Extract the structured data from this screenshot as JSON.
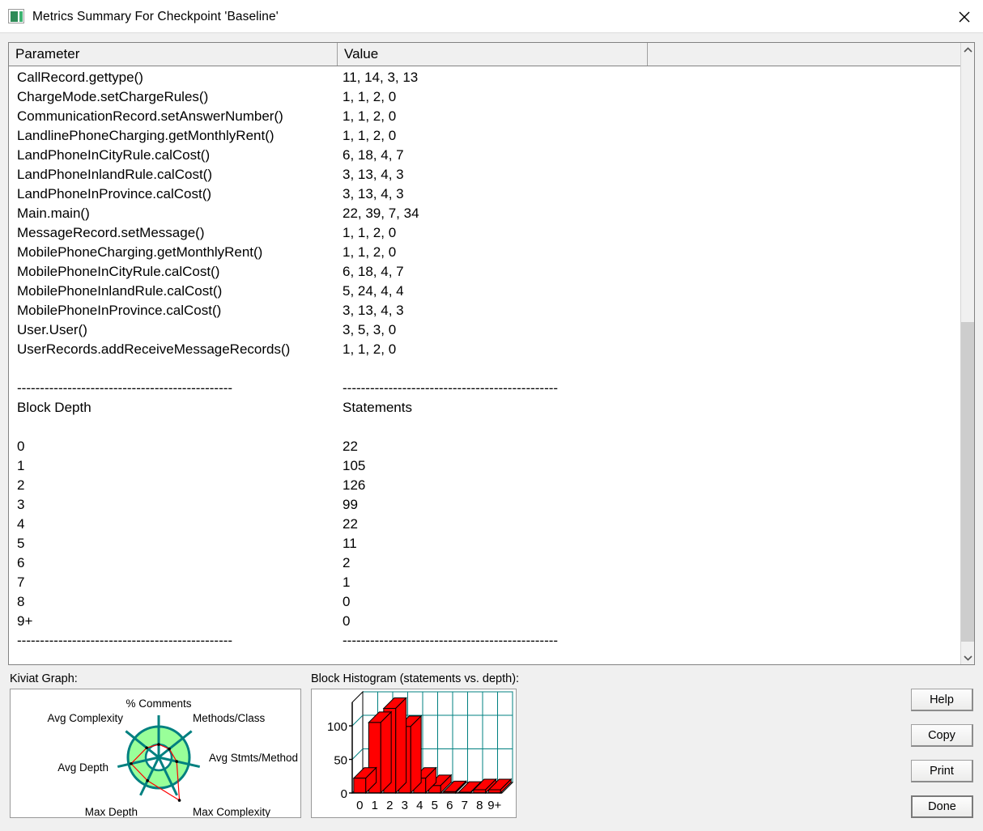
{
  "window": {
    "title": "Metrics Summary For Checkpoint 'Baseline'",
    "icon": "metrics-window-icon",
    "close_icon": "close-icon"
  },
  "report": {
    "columns": [
      "Parameter",
      "Value",
      ""
    ],
    "rows": [
      {
        "parameter": "CallRecord.gettype()",
        "value": "11, 14, 3, 13"
      },
      {
        "parameter": "ChargeMode.setChargeRules()",
        "value": "1, 1, 2, 0"
      },
      {
        "parameter": "CommunicationRecord.setAnswerNumber()",
        "value": "1, 1, 2, 0"
      },
      {
        "parameter": "LandlinePhoneCharging.getMonthlyRent()",
        "value": "1, 1, 2, 0"
      },
      {
        "parameter": "LandPhoneInCityRule.calCost()",
        "value": "6, 18, 4, 7"
      },
      {
        "parameter": "LandPhoneInlandRule.calCost()",
        "value": "3, 13, 4, 3"
      },
      {
        "parameter": "LandPhoneInProvince.calCost()",
        "value": "3, 13, 4, 3"
      },
      {
        "parameter": "Main.main()",
        "value": "22, 39, 7, 34"
      },
      {
        "parameter": "MessageRecord.setMessage()",
        "value": "1, 1, 2, 0"
      },
      {
        "parameter": "MobilePhoneCharging.getMonthlyRent()",
        "value": "1, 1, 2, 0"
      },
      {
        "parameter": "MobilePhoneInCityRule.calCost()",
        "value": "6, 18, 4, 7"
      },
      {
        "parameter": "MobilePhoneInlandRule.calCost()",
        "value": "5, 24, 4, 4"
      },
      {
        "parameter": "MobilePhoneInProvince.calCost()",
        "value": "3, 13, 4, 3"
      },
      {
        "parameter": "User.User()",
        "value": "3, 5, 3, 0"
      },
      {
        "parameter": "UserRecords.addReceiveMessageRecords()",
        "value": "1, 1, 2, 0"
      }
    ],
    "separator": "-----------------------------------------------",
    "block_section": {
      "header_left": "Block Depth",
      "header_right": "Statements",
      "rows": [
        {
          "depth": "0",
          "statements": "22"
        },
        {
          "depth": "1",
          "statements": "105"
        },
        {
          "depth": "2",
          "statements": "126"
        },
        {
          "depth": "3",
          "statements": "99"
        },
        {
          "depth": "4",
          "statements": "22"
        },
        {
          "depth": "5",
          "statements": "11"
        },
        {
          "depth": "6",
          "statements": "2"
        },
        {
          "depth": "7",
          "statements": "1"
        },
        {
          "depth": "8",
          "statements": "0"
        },
        {
          "depth": "9+",
          "statements": "0"
        }
      ]
    }
  },
  "scrollbar": {
    "up_icon": "chevron-up-icon",
    "down_icon": "chevron-down-icon"
  },
  "kiviat": {
    "label": "Kiviat Graph:",
    "axes": [
      "% Comments",
      "Methods/Class",
      "Avg Stmts/Method",
      "Max Complexity",
      "Max Depth",
      "Avg Depth",
      "Avg Complexity"
    ],
    "colors": {
      "band": "#99ff99",
      "spoke": "#008080",
      "series": "#ff0000"
    }
  },
  "histogram": {
    "label": "Block Histogram (statements vs. depth):",
    "colors": {
      "bar_front": "#ff0000",
      "bar_outline": "#000000",
      "grid": "#008080"
    }
  },
  "chart_data": {
    "type": "bar",
    "title": "Block Histogram (statements vs. depth)",
    "xlabel": "",
    "ylabel": "",
    "categories": [
      "0",
      "1",
      "2",
      "3",
      "4",
      "5",
      "6",
      "7",
      "8",
      "9+"
    ],
    "values": [
      22,
      105,
      126,
      99,
      22,
      11,
      2,
      1,
      0,
      0
    ],
    "yticks": [
      0,
      50,
      100
    ],
    "ylim": [
      0,
      135
    ],
    "grid": true,
    "legend": null
  },
  "buttons": {
    "help": "Help",
    "copy": "Copy",
    "print": "Print",
    "done": "Done"
  }
}
